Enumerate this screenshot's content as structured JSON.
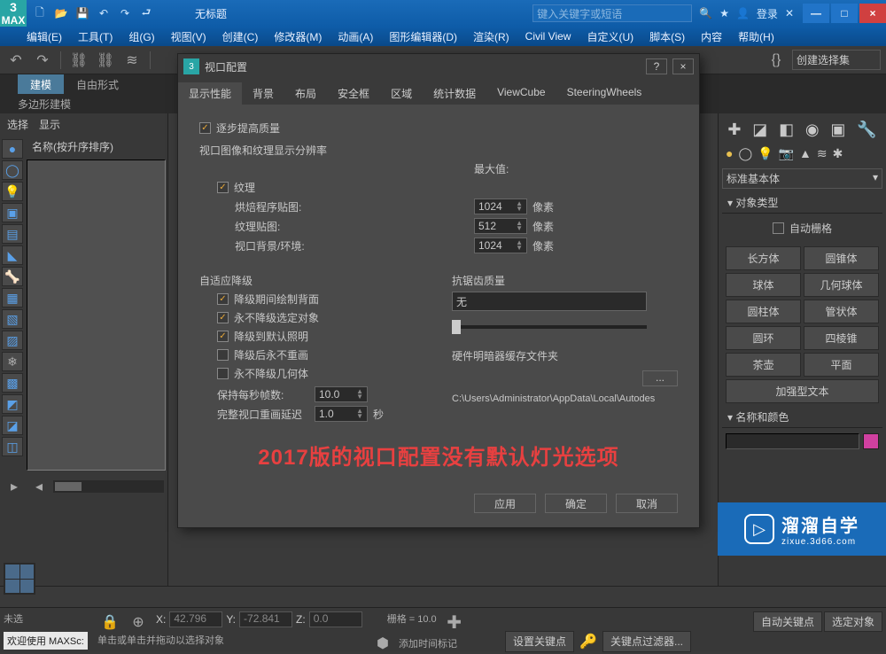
{
  "titlebar": {
    "app_short": "3",
    "app_sub": "MAX",
    "title": "无标题",
    "search_placeholder": "键入关键字或短语",
    "login": "登录",
    "min": "—",
    "max": "□",
    "close": "×"
  },
  "menubar": [
    "编辑(E)",
    "工具(T)",
    "组(G)",
    "视图(V)",
    "创建(C)",
    "修改器(M)",
    "动画(A)",
    "图形编辑器(D)",
    "渲染(R)",
    "Civil View",
    "自定义(U)",
    "脚本(S)",
    "内容",
    "帮助(H)"
  ],
  "main_toolbar": {
    "create_select_label": "创建选择集"
  },
  "ribbon": {
    "tabs": [
      "建模",
      "自由形式"
    ],
    "active": 0,
    "sub": "多边形建模"
  },
  "left": {
    "tabs": [
      "选择",
      "显示"
    ],
    "list_header": "名称(按升序排序)"
  },
  "right": {
    "category": "标准基本体",
    "rollouts": {
      "obj_type": "对象类型",
      "autogrid": "自动栅格",
      "name_color": "名称和颜色"
    },
    "primitives": [
      "长方体",
      "圆锥体",
      "球体",
      "几何球体",
      "圆柱体",
      "管状体",
      "圆环",
      "四棱锥",
      "茶壶",
      "平面",
      "加强型文本"
    ]
  },
  "dialog": {
    "title": "视口配置",
    "help_icon": "?",
    "close_icon": "×",
    "tabs": [
      "显示性能",
      "背景",
      "布局",
      "安全框",
      "区域",
      "统计数据",
      "ViewCube",
      "SteeringWheels"
    ],
    "active_tab": 0,
    "progressive": "逐步提高质量",
    "resolution_header": "视口图像和纹理显示分辨率",
    "max_label": "最大值:",
    "rows": [
      {
        "chk": true,
        "label": "纹理",
        "val": "",
        "unit": ""
      },
      {
        "chk": false,
        "label": "烘焙程序贴图:",
        "val": "1024",
        "unit": "像素"
      },
      {
        "chk": false,
        "label": "纹理贴图:",
        "val": "512",
        "unit": "像素"
      },
      {
        "chk": false,
        "label": "视口背景/环境:",
        "val": "1024",
        "unit": "像素"
      }
    ],
    "adaptive_header": "自适应降级",
    "adaptive": [
      {
        "chk": true,
        "label": "降级期间绘制背面"
      },
      {
        "chk": true,
        "label": "永不降级选定对象"
      },
      {
        "chk": true,
        "label": "降级到默认照明"
      },
      {
        "chk": false,
        "label": "降级后永不重画"
      },
      {
        "chk": false,
        "label": "永不降级几何体"
      }
    ],
    "fps_label": "保持每秒帧数:",
    "fps_val": "10.0",
    "delay_label": "完整视口重画延迟",
    "delay_val": "1.0",
    "delay_unit": "秒",
    "aa_header": "抗锯齿质量",
    "aa_value": "无",
    "cache_header": "硬件明暗器缓存文件夹",
    "browse": "...",
    "cache_path": "C:\\Users\\Administrator\\AppData\\Local\\Autodes",
    "overlay": "2017版的视口配置没有默认灯光选项",
    "buttons": {
      "apply": "应用",
      "ok": "确定",
      "cancel": "取消"
    }
  },
  "status": {
    "selection": "未选",
    "x_label": "X:",
    "x": "42.796",
    "y_label": "Y:",
    "y": "-72.841",
    "z_label": "Z:",
    "z": "0.0",
    "grid": "栅格 = 10.0",
    "add_time": "添加时间标记",
    "auto_key": "自动关键点",
    "sel_obj": "选定对象",
    "set_key": "设置关键点",
    "key_filter": "关键点过滤器...",
    "prompt": "单击或单击并拖动以选择对象",
    "maxscript": "欢迎使用  MAXSc:"
  },
  "watermark": {
    "name": "溜溜自学",
    "url": "zixue.3d66.com"
  }
}
